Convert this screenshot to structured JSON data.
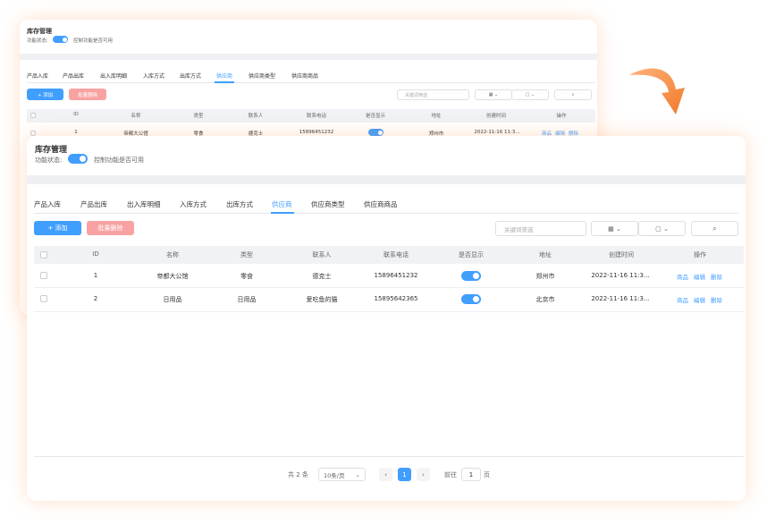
{
  "page": {
    "title": "库存管理",
    "status_label": "功能状态:",
    "status_desc": "控制功能是否可用"
  },
  "tabs": [
    {
      "label": "产品入库"
    },
    {
      "label": "产品出库"
    },
    {
      "label": "出入库明细"
    },
    {
      "label": "入库方式"
    },
    {
      "label": "出库方式"
    },
    {
      "label": "供应商"
    },
    {
      "label": "供应商类型"
    },
    {
      "label": "供应商商品"
    }
  ],
  "active_tab": "供应商",
  "toolbar": {
    "add_label": "+ 添加",
    "batch_delete_label": "批量删除",
    "search_placeholder": "关键词筛选"
  },
  "table": {
    "columns": [
      "ID",
      "名称",
      "类型",
      "联系人",
      "联系电话",
      "是否显示",
      "地址",
      "创建时间",
      "操作"
    ],
    "rows": [
      {
        "id": "1",
        "name": "帝都大公馆",
        "type": "零食",
        "contact": "德克士",
        "phone": "15896451232",
        "visible": true,
        "address": "郑州市",
        "created": "2022-11-16 11:3...",
        "actions": [
          "商品",
          "编辑",
          "删除"
        ]
      },
      {
        "id": "2",
        "name": "日用品",
        "type": "日用品",
        "contact": "爱吃鱼的猫",
        "phone": "15895642365",
        "visible": true,
        "address": "北京市",
        "created": "2022-11-16 11:3...",
        "actions": [
          "商品",
          "编辑",
          "删除"
        ]
      }
    ]
  },
  "pagination": {
    "total_text": "共 2 条",
    "page_size": "10条/页",
    "current_page": "1",
    "goto_label": "前往",
    "goto_value": "1",
    "page_suffix": "页"
  },
  "colors": {
    "primary": "#409eff",
    "danger_light": "#f8a2a2",
    "glow": "#ff8c3c"
  }
}
